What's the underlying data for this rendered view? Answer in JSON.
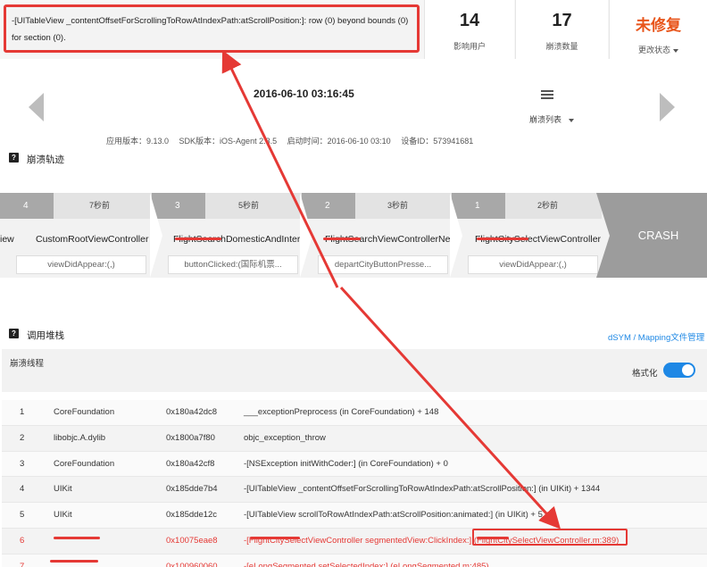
{
  "error": {
    "message": "-[UITableView _contentOffsetForScrollingToRowAtIndexPath:atScrollPosition:]: row (0) beyond bounds (0) for section (0)."
  },
  "stats": {
    "users": {
      "value": "14",
      "label": "影响用户"
    },
    "crashes": {
      "value": "17",
      "label": "崩溃数量"
    },
    "status": {
      "value": "未修复",
      "label": "更改状态"
    }
  },
  "crash": {
    "time": "2016-06-10 03:16:45",
    "list_label": "崩溃列表"
  },
  "meta": {
    "app_version": "应用版本：9.13.0",
    "sdk_version": "SDK版本：iOS-Agent 2.3.5",
    "launch_time": "启动时间：2016-06-10 03:10",
    "device_id": "设备ID：573941681"
  },
  "trail": {
    "title": "崩溃轨迹",
    "edge_partial": "iew",
    "steps": [
      {
        "index": "4",
        "ago": "7秒前",
        "vc": "CustomRootViewController",
        "method": "viewDidAppear:(,)"
      },
      {
        "index": "3",
        "ago": "5秒前",
        "vc": "FlightSearchDomesticAndInter...",
        "method": "buttonClicked:(国际机票..."
      },
      {
        "index": "2",
        "ago": "3秒前",
        "vc": "FlightSearchViewControllerNew",
        "method": "departCityButtonPresse..."
      },
      {
        "index": "1",
        "ago": "2秒前",
        "vc": "FlightCitySelectViewController",
        "method": "viewDidAppear:(,)"
      }
    ],
    "crash_label": "CRASH"
  },
  "stack": {
    "title": "调用堆栈",
    "mapping_link": "dSYM / Mapping文件管理",
    "thread_label": "崩溃线程",
    "format_label": "格式化",
    "rows": [
      {
        "n": "1",
        "lib": "CoreFoundation",
        "addr": "0x180a42dc8",
        "sym": "___exceptionPreprocess (in CoreFoundation) + 148"
      },
      {
        "n": "2",
        "lib": "libobjc.A.dylib",
        "addr": "0x1800a7f80",
        "sym": "objc_exception_throw"
      },
      {
        "n": "3",
        "lib": "CoreFoundation",
        "addr": "0x180a42cf8",
        "sym": "-[NSException initWithCoder:] (in CoreFoundation) + 0"
      },
      {
        "n": "4",
        "lib": "UIKit",
        "addr": "0x185dde7b4",
        "sym": "-[UITableView _contentOffsetForScrollingToRowAtIndexPath:atScrollPosition:] (in UIKit) + 1344"
      },
      {
        "n": "5",
        "lib": "UIKit",
        "addr": "0x185dde12c",
        "sym": "-[UITableView scrollToRowAtIndexPath:atScrollPosition:animated:] (in UIKit) + 5"
      },
      {
        "n": "6",
        "lib": "",
        "addr": "0x10075eae8",
        "sym": "-[FlightCitySelectViewController segmentedView:ClickIndex:] (FlightCitySelectViewController.m:389)"
      },
      {
        "n": "7",
        "lib": "",
        "addr": "0x100960060",
        "sym": "-[eLongSegmented setSelectedIndex:] (eLongSegmented.m:485)"
      }
    ]
  },
  "colors": {
    "annotation_red": "#e53935",
    "link_blue": "#1e88e5",
    "status_orange": "#e8541a"
  }
}
